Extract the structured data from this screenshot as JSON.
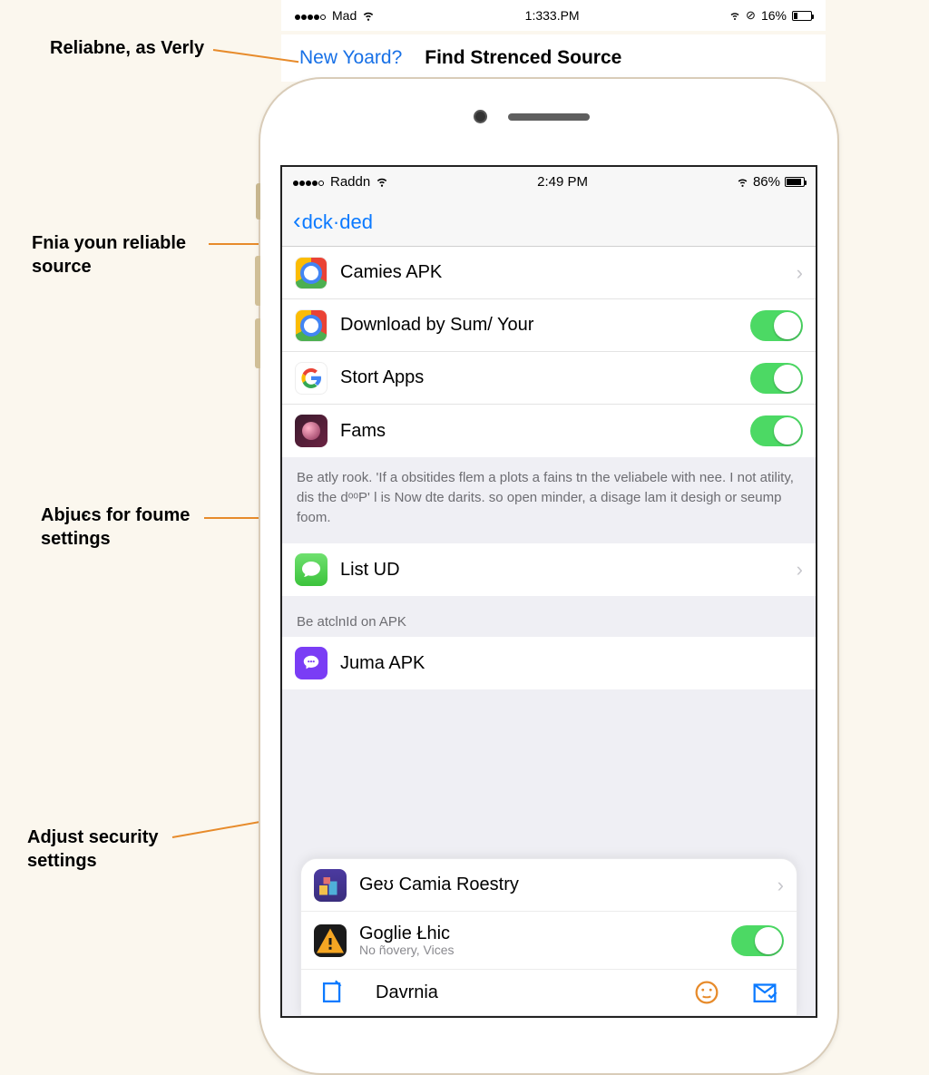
{
  "outer_status": {
    "carrier": "Mad",
    "time": "1:333.PM",
    "battery": "16%"
  },
  "outer_heading": {
    "link": "New Yoard?",
    "title": "Find Strenced Source"
  },
  "callouts": {
    "c1": "Reliabne, as Verly",
    "c2a": "Fnia youn reliable",
    "c2b": "source",
    "c3a": "Abjuєs for foume",
    "c3b": "settings",
    "c4a": "Adjust security",
    "c4b": "settings"
  },
  "inner_status": {
    "carrier": "Raddn",
    "time": "2:49 PM",
    "battery": "86%"
  },
  "nav": {
    "back_label": "dck·ded"
  },
  "rows": {
    "r1": "Camies APK",
    "r2": "Download by Sum/ Your",
    "r3": "Stort Apps",
    "r4": "Fams",
    "r5": "List UD",
    "r6": "Juma APK",
    "r7": "Geʊ Camia Roestry",
    "r8": "Goglie Łhic",
    "r8_sub": "No ñovery, Vices",
    "r9": "Davrnia"
  },
  "notes": {
    "n1": "Be atly rook. 'If a obsitides flem a plots a fains tn the veliabele with nee. I not atility, dis the dᵒᵒP' l is Now dte darits. so open minder, a disage lam it desigh or seump foom.",
    "n2": "Be atclnId on APK"
  },
  "icons": {
    "chrome": "chrome-icon",
    "g": "google-icon",
    "fams": "fams-icon",
    "msg": "messages-icon",
    "juma": "juma-icon",
    "ges": "ges-icon",
    "warn": "warning-icon",
    "toggle": "toggle-on"
  }
}
